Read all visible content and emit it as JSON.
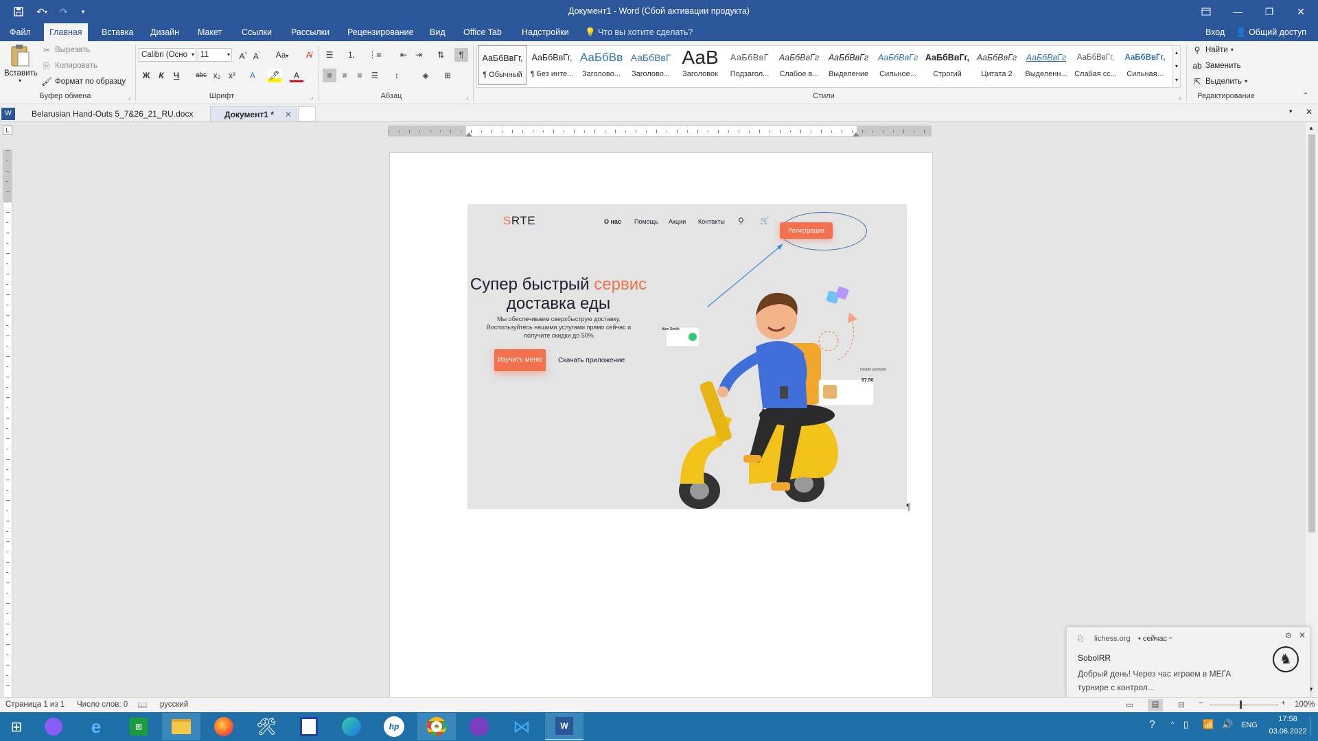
{
  "window": {
    "title": "Документ1 - Word (Сбой активации продукта)"
  },
  "ribbon_tabs": [
    "Файл",
    "Главная",
    "Вставка",
    "Дизайн",
    "Макет",
    "Ссылки",
    "Рассылки",
    "Рецензирование",
    "Вид",
    "Office Tab",
    "Надстройки"
  ],
  "tell_me": "Что вы хотите сделать?",
  "account": {
    "signin": "Вход",
    "share": "Общий доступ"
  },
  "clipboard": {
    "paste": "Вставить",
    "cut": "Вырезать",
    "copy": "Копировать",
    "format_painter": "Формат по образцу",
    "label": "Буфер обмена"
  },
  "font": {
    "name": "Calibri (Осно",
    "size": "11",
    "case": "Аа",
    "bold": "Ж",
    "italic": "К",
    "underline": "Ч",
    "strike": "abc",
    "sub": "x₂",
    "sup": "x²",
    "label": "Шрифт"
  },
  "paragraph": {
    "label": "Абзац"
  },
  "styles": {
    "label": "Стили",
    "items": [
      {
        "preview": "АаБбВвГг,",
        "name": "¶ Обычный"
      },
      {
        "preview": "АаБбВвГг,",
        "name": "¶ Без инте..."
      },
      {
        "preview": "АаБбВв",
        "name": "Заголово..."
      },
      {
        "preview": "АаБбВвГ",
        "name": "Заголово..."
      },
      {
        "preview": "АаВ",
        "name": "Заголовок"
      },
      {
        "preview": "АаБбВвГ",
        "name": "Подзагол..."
      },
      {
        "preview": "АаБбВвГг",
        "name": "Слабое в..."
      },
      {
        "preview": "АаБбВвГг",
        "name": "Выделение"
      },
      {
        "preview": "АаБбВвГг",
        "name": "Сильное..."
      },
      {
        "preview": "АаБбВвГг,",
        "name": "Строгий"
      },
      {
        "preview": "АаБбВвГг",
        "name": "Цитата 2"
      },
      {
        "preview": "АаБбВвГг",
        "name": "Выделенн..."
      },
      {
        "preview": "АаБбВвГг,",
        "name": "Слабая сс..."
      },
      {
        "preview": "АаБбВвГг,",
        "name": "Сильная..."
      }
    ]
  },
  "editing": {
    "find": "Найти",
    "replace": "Заменить",
    "select": "Выделить",
    "label": "Редактирование"
  },
  "doc_tabs": [
    {
      "label": "Belarusian Hand-Outs 5_7&26_21_RU.docx"
    },
    {
      "label": "Документ1 *"
    }
  ],
  "site": {
    "logo_s": "S",
    "logo_rest": "RTE",
    "nav": [
      "О нас",
      "Помощь",
      "Акции",
      "Контакты"
    ],
    "register": "Регистрация",
    "headline_1": "Супер быстрый",
    "headline_accent": "сервис",
    "headline_2": "доставка еды",
    "description": "Мы обеспечиваем сверхбыструю доставку. Воспользуйтесь нашими услугами прямо сейчас и получите скидки до 50%",
    "cta_menu": "Изучить меню",
    "cta_app": "Скачать приложение",
    "card_person": "Alex Smith",
    "card_food": "Double sandwich",
    "card_price": "$7.50"
  },
  "status": {
    "page": "Страница 1 из 1",
    "words": "Число слов: 0",
    "language": "русский",
    "zoom": "100%"
  },
  "notification": {
    "source": "lichess.org",
    "time": "• сейчас",
    "sender": "SobolRR",
    "message": "Добрый день! Через час играем в МЕГА турнире с контрол..."
  },
  "taskbar": {
    "lang": "ENG",
    "time": "17:58",
    "date": "03.06.2022"
  },
  "colors": {
    "word_blue": "#2b579a",
    "accent_orange": "#f4714f",
    "taskbar": "#1e6ea7"
  }
}
